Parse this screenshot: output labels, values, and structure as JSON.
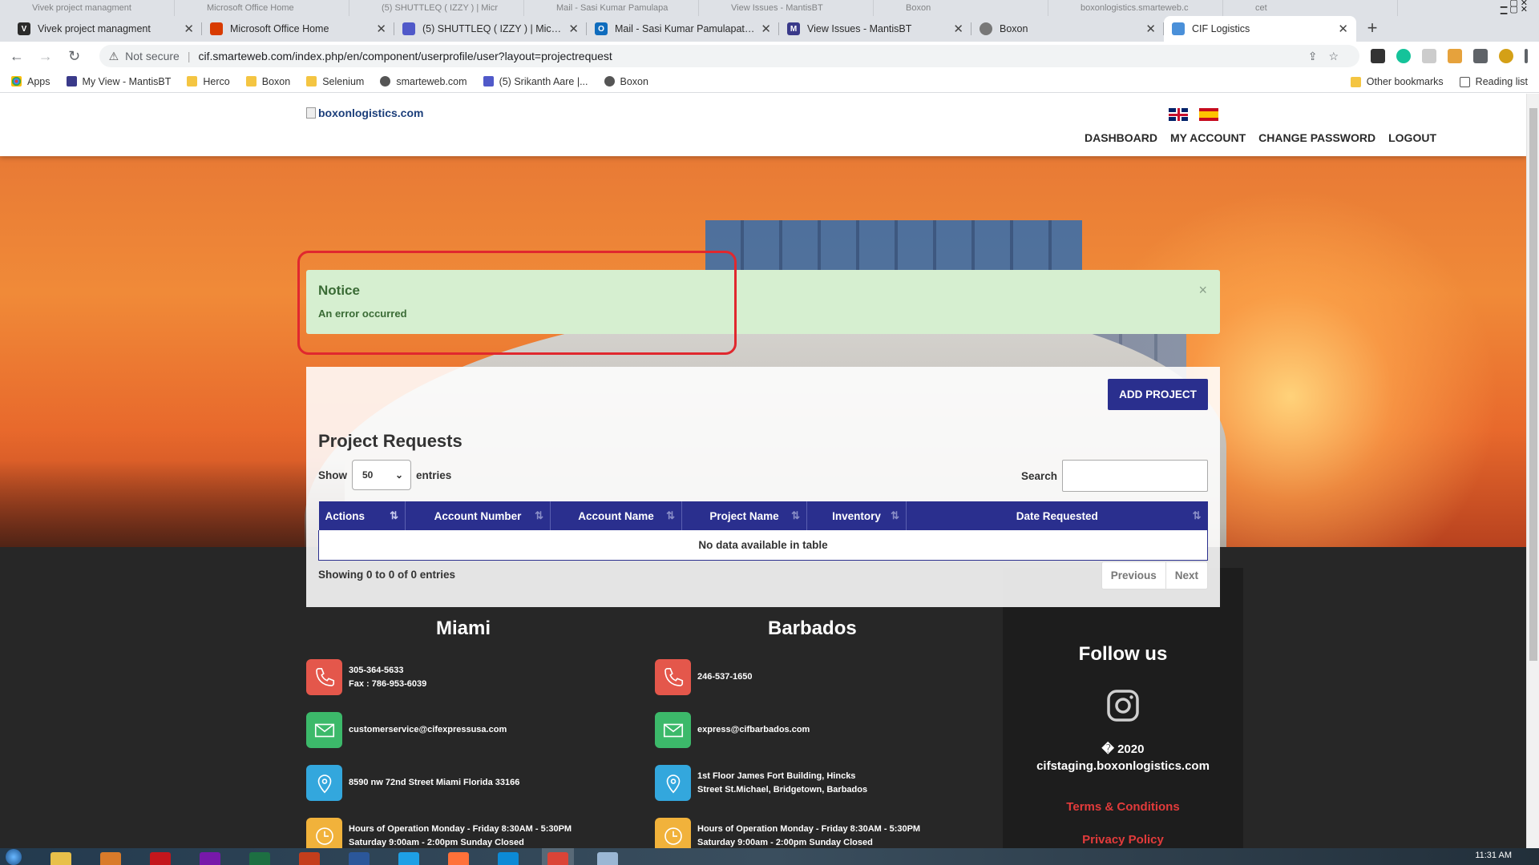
{
  "browser": {
    "background_tabs": [
      "Vivek project managment",
      "Microsoft Office Home",
      "(5) SHUTTLEQ ( IZZY ) | Micr",
      "Mail - Sasi Kumar Pamulapa",
      "View Issues - MantisBT",
      "Boxon",
      "boxonlogistics.smarteweb.c",
      "cet"
    ],
    "tabs": [
      {
        "title": "Vivek project managment",
        "icon": "vivek-favicon",
        "color": "#2b2b2b"
      },
      {
        "title": "Microsoft Office Home",
        "icon": "office-favicon",
        "color": "#d83b01"
      },
      {
        "title": "(5) SHUTTLEQ ( IZZY ) | Microsoft",
        "icon": "teams-favicon",
        "color": "#5059c9"
      },
      {
        "title": "Mail - Sasi Kumar Pamulapati - O",
        "icon": "outlook-favicon",
        "color": "#0f6cbd"
      },
      {
        "title": "View Issues - MantisBT",
        "icon": "mantis-favicon",
        "color": "#3a3a8a"
      },
      {
        "title": "Boxon",
        "icon": "globe-favicon",
        "color": "#777777"
      },
      {
        "title": "CIF Logistics",
        "icon": "cif-favicon",
        "color": "#4a90d9"
      }
    ],
    "new_tab": "+",
    "toolbar": {
      "back": "←",
      "forward": "→",
      "reload": "↻"
    },
    "security_label": "Not secure",
    "url": "cif.smarteweb.com/index.php/en/component/userprofile/user?layout=projectrequest",
    "bookmarks": [
      {
        "label": "Apps",
        "icon": "apps-grid-icon"
      },
      {
        "label": "My View - MantisBT",
        "icon": "mantis-icon"
      },
      {
        "label": "Herco",
        "icon": "folder-icon"
      },
      {
        "label": "Boxon",
        "icon": "folder-icon"
      },
      {
        "label": "Selenium",
        "icon": "folder-icon"
      },
      {
        "label": "smarteweb.com",
        "icon": "globe-icon"
      },
      {
        "label": "(5) Srikanth Aare |...",
        "icon": "teams-icon"
      },
      {
        "label": "Boxon",
        "icon": "globe-icon"
      }
    ],
    "other_bookmarks": "Other bookmarks",
    "reading_list": "Reading list"
  },
  "header": {
    "logo_alt": "boxonlogistics.com",
    "nav": [
      "DASHBOARD",
      "MY ACCOUNT",
      "CHANGE PASSWORD",
      "LOGOUT"
    ]
  },
  "notice": {
    "title": "Notice",
    "message": "An error occurred",
    "close": "×"
  },
  "panel": {
    "add_button": "ADD PROJECT",
    "title": "Project Requests",
    "show_label": "Show",
    "entries_value": "50",
    "entries_label": "entries",
    "search_label": "Search",
    "columns": [
      "Actions",
      "Account Number",
      "Account Name",
      "Project Name",
      "Inventory",
      "Date Requested"
    ],
    "empty_message": "No data available in table",
    "info": "Showing 0 to 0 of 0 entries",
    "prev": "Previous",
    "next": "Next"
  },
  "footer": {
    "miami": {
      "title": "Miami",
      "phone": "305-364-5633",
      "fax": "Fax : 786-953-6039",
      "email": "customerservice@cifexpressusa.com",
      "address": "8590 nw 72nd Street Miami Florida 33166",
      "hours_1": "Hours of Operation Monday - Friday 8:30AM - 5:30PM",
      "hours_2": "Saturday 9:00am - 2:00pm Sunday Closed"
    },
    "barbados": {
      "title": "Barbados",
      "phone": "246-537-1650",
      "email": "express@cifbarbados.com",
      "address_1": "1st Floor James Fort Building, Hincks",
      "address_2": "Street St.Michael, Bridgetown, Barbados",
      "hours_1": "Hours of Operation Monday - Friday 8:30AM - 5:30PM",
      "hours_2": "Saturday 9:00am - 2:00pm Sunday Closed"
    },
    "follow_title": "Follow us",
    "copyright_1": "� 2020",
    "copyright_2": "cifstaging.boxonlogistics.com",
    "terms": "Terms & Conditions",
    "privacy": "Privacy Policy"
  },
  "taskbar": {
    "clock": "11:31 AM"
  },
  "colors": {
    "primary": "#2a2f8e",
    "notice_bg": "#d6efd0",
    "notice_text": "#3a6b35",
    "annotation": "#e0282e",
    "footer_bg": "#272727",
    "link_red": "#e23b3b"
  }
}
